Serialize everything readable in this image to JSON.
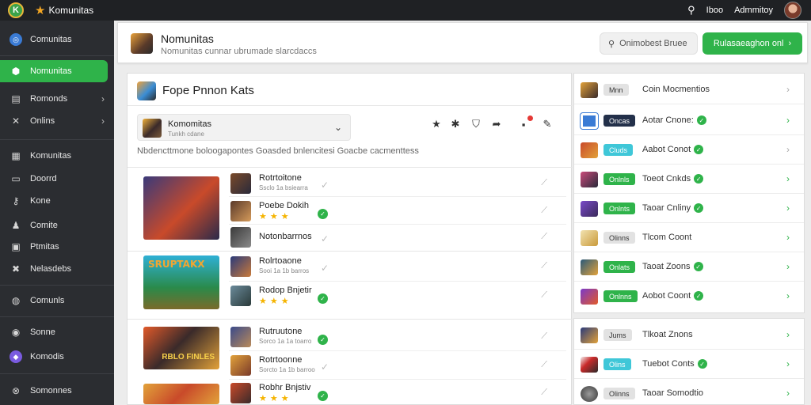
{
  "topbar": {
    "app_title": "Komunitas",
    "search_icon": "search-icon",
    "link1": "Iboo",
    "user_name": "Admmitoy"
  },
  "sidebar": {
    "items": [
      {
        "label": "Comunitas",
        "icon": "compass-icon"
      },
      {
        "label": "Nomunitas",
        "icon": "community-icon"
      },
      {
        "label": "Romonds",
        "icon": "inbox-icon"
      },
      {
        "label": "Onlins",
        "icon": "tools-icon"
      },
      {
        "label": "Komunitas",
        "icon": "grid-icon"
      },
      {
        "label": "Doorrd",
        "icon": "board-icon"
      },
      {
        "label": "Kone",
        "icon": "key-icon"
      },
      {
        "label": "Comite",
        "icon": "people-icon"
      },
      {
        "label": "Ptmitas",
        "icon": "list-icon"
      },
      {
        "label": "Nelasdebs",
        "icon": "cross-tools-icon"
      },
      {
        "label": "Comunls",
        "icon": "globe-icon"
      },
      {
        "label": "Sonne",
        "icon": "sun-icon"
      },
      {
        "label": "Komodis",
        "icon": "discord-icon"
      },
      {
        "label": "Somonnes",
        "icon": "close-circle-icon"
      }
    ]
  },
  "header": {
    "title": "Nomunitas",
    "subtitle": "Nomunitas cunnar ubrumade slarcdaccs",
    "search_placeholder": "Onimobest Bruee",
    "primary_button": "Rulasaeaghon onl"
  },
  "main": {
    "title": "Fope Pnnon Kats",
    "dropdown": {
      "title": "Komomitas",
      "subtitle": "Tunkh cdane"
    },
    "toolbar_icons": [
      "star-icon",
      "puzzle-icon",
      "shield-icon",
      "share-icon",
      "gift-icon",
      "edit-icon"
    ],
    "description": "Nbdencttmone boloogapontes Goasded bnlencitesi Goacbe cacmenttess",
    "rows": [
      {
        "title": "Rotrtoitone",
        "sub": "Ssclo 1a bsiearra",
        "rating": "",
        "status": "grey"
      },
      {
        "title": "Poebe Dokih",
        "sub": "",
        "rating": "★★★",
        "status": "green"
      },
      {
        "title": "Notonbarrnos",
        "sub": "",
        "rating": "",
        "status": "grey"
      },
      {
        "title": "Rolrtoaone",
        "sub": "Sooi 1a 1b barros",
        "rating": "",
        "status": "grey"
      },
      {
        "title": "Rodop Bnjetir",
        "sub": "",
        "rating": "★★★",
        "status": "green"
      },
      {
        "title": "Rutruutone",
        "sub": "Sorco 1a 1a toarro",
        "rating": "",
        "status": "green"
      },
      {
        "title": "Rotrtoonne",
        "sub": "Sorcto 1a 1b barroo",
        "rating": "",
        "status": "grey"
      },
      {
        "title": "Robhr Bnjstiv",
        "sub": "",
        "rating": "★★★",
        "status": "green"
      }
    ],
    "banner_texts": [
      "",
      "SRUPTAKX",
      "RBLO FINLES"
    ]
  },
  "right_panel": {
    "items": [
      {
        "tag": "Mnn",
        "tag_style": "grey",
        "label": "Coin Mocmentios",
        "check": false,
        "chev": "s"
      },
      {
        "tag": "Oncas",
        "tag_style": "navy",
        "label": "Aotar Cnone:",
        "check": true,
        "chev": "g"
      },
      {
        "tag": "Cluds",
        "tag_style": "cyan",
        "label": "Aabot Conot",
        "check": true,
        "chev": "s"
      },
      {
        "tag": "Onlnls",
        "tag_style": "green",
        "label": "Toeot Cnkds",
        "check": true,
        "chev": "g"
      },
      {
        "tag": "Onlnts",
        "tag_style": "green",
        "label": "Taoar Cnliny",
        "check": true,
        "chev": "g"
      },
      {
        "tag": "Olinns",
        "tag_style": "grey",
        "label": "Tlcom Coont",
        "check": false,
        "chev": "g"
      },
      {
        "tag": "Onlats",
        "tag_style": "green",
        "label": "Taoat Zoons",
        "check": true,
        "chev": "g"
      },
      {
        "tag": "Onlnns",
        "tag_style": "green",
        "label": "Aobot Coont",
        "check": true,
        "chev": "g"
      }
    ],
    "items2": [
      {
        "tag": "Jums",
        "tag_style": "grey",
        "label": "Tlkoat Znons",
        "check": false,
        "chev": "g"
      },
      {
        "tag": "Olins",
        "tag_style": "cyan",
        "label": "Tuebot Conts",
        "check": true,
        "chev": "g"
      },
      {
        "tag": "Olinns",
        "tag_style": "grey",
        "label": "Taoar Somodtio",
        "check": false,
        "chev": "g"
      }
    ]
  }
}
